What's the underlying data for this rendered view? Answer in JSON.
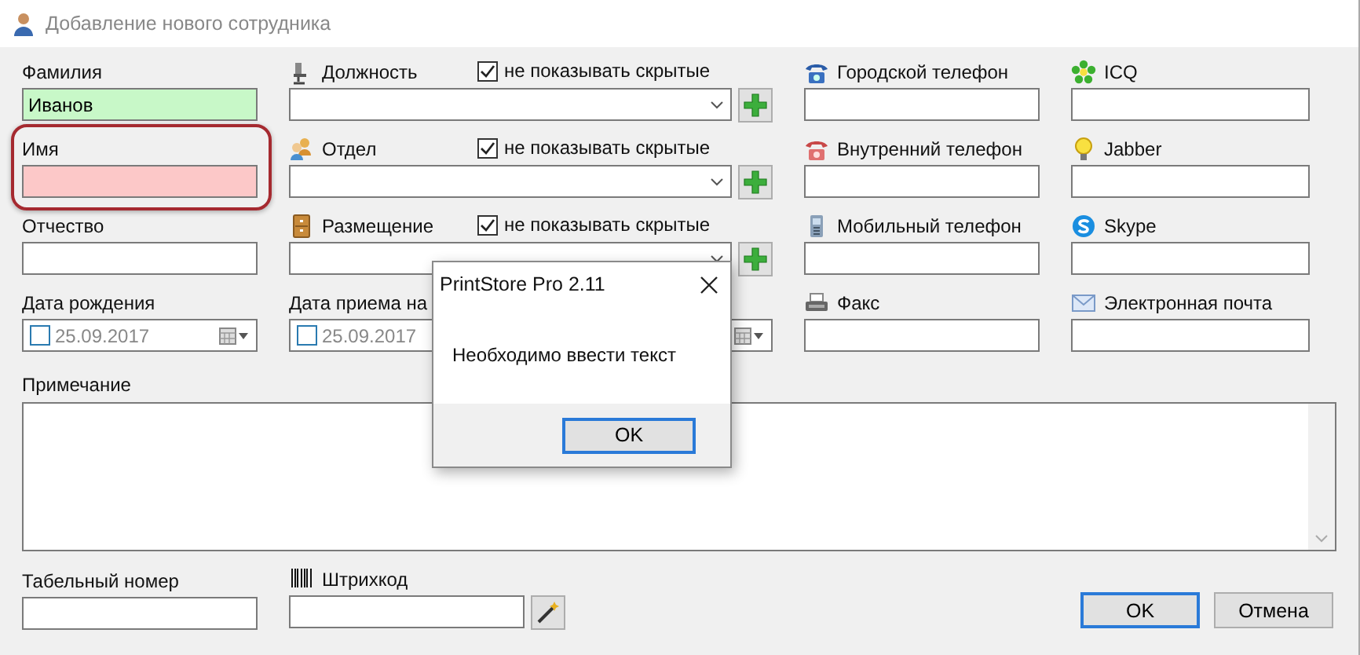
{
  "window": {
    "title": "Добавление нового сотрудника"
  },
  "rows": [
    [
      {
        "kind": "text",
        "label": "Фамилия",
        "value": "Иванов",
        "valid": true,
        "highlighted": false
      },
      {
        "kind": "combo",
        "label": "Должность",
        "filter": {
          "label": "не показывать скрытые",
          "checked": true
        },
        "highlighted": false
      },
      {
        "kind": "text",
        "label": "Городской телефон",
        "highlighted": false
      },
      {
        "kind": "text",
        "label": "ICQ",
        "highlighted": false
      }
    ],
    [
      {
        "kind": "text",
        "label": "Имя",
        "valid": false,
        "highlighted": true
      },
      {
        "kind": "combo",
        "label": "Отдел",
        "filter": {
          "label": "не показывать скрытые",
          "checked": true
        },
        "highlighted": false
      },
      {
        "kind": "text",
        "label": "Внутренний телефон",
        "highlighted": false
      },
      {
        "kind": "text",
        "label": "Jabber",
        "highlighted": false
      }
    ],
    [
      {
        "kind": "text",
        "label": "Отчество",
        "highlighted": false
      },
      {
        "kind": "combo",
        "label": "Размещение",
        "filter": {
          "label": "не показывать скрытые",
          "checked": true
        },
        "highlighted": false
      },
      {
        "kind": "text",
        "label": "Мобильный телефон",
        "highlighted": false
      },
      {
        "kind": "text",
        "label": "Skype",
        "highlighted": false
      }
    ],
    [
      {
        "kind": "date",
        "label": "Дата рождения",
        "value": "25.09.2017",
        "checked": false,
        "highlighted": false
      },
      {
        "kind": "date",
        "label": "Дата приема на",
        "value": "25.09.2017",
        "checked": false,
        "highlighted": false
      },
      {
        "kind": "text",
        "label": "Факс",
        "highlighted": false
      },
      {
        "kind": "text",
        "label": "Электронная почта",
        "highlighted": false
      }
    ]
  ],
  "notes": {
    "label": "Примечание"
  },
  "bottom_fields": [
    {
      "label": "Табельный номер"
    },
    {
      "label": "Штрихкод"
    }
  ],
  "buttons": [
    {
      "label": "OK",
      "default": true
    },
    {
      "label": "Отмена",
      "default": false
    }
  ],
  "dialog": {
    "title": "PrintStore Pro 2.11",
    "message": "Необходимо ввести текст",
    "button": "OK"
  }
}
